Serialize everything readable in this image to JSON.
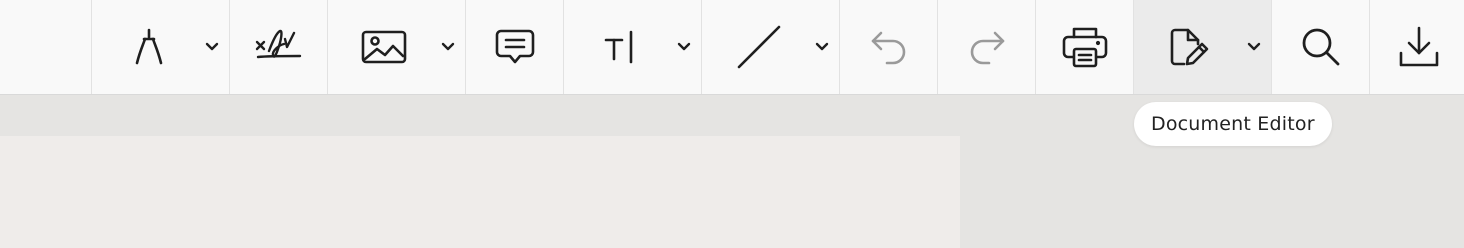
{
  "toolbar": {
    "tools": [
      {
        "id": "pen",
        "icon": "pen-nib-icon",
        "has_dropdown": true
      },
      {
        "id": "signature",
        "icon": "signature-icon",
        "has_dropdown": false
      },
      {
        "id": "image",
        "icon": "image-icon",
        "has_dropdown": true
      },
      {
        "id": "comment",
        "icon": "comment-icon",
        "has_dropdown": false
      },
      {
        "id": "text",
        "icon": "text-cursor-icon",
        "has_dropdown": true
      },
      {
        "id": "line",
        "icon": "line-icon",
        "has_dropdown": true
      },
      {
        "id": "undo",
        "icon": "undo-icon",
        "has_dropdown": false,
        "disabled": true
      },
      {
        "id": "redo",
        "icon": "redo-icon",
        "has_dropdown": false,
        "disabled": true
      },
      {
        "id": "print",
        "icon": "printer-icon",
        "has_dropdown": false
      },
      {
        "id": "document-editor",
        "icon": "document-edit-icon",
        "has_dropdown": true,
        "active": true
      },
      {
        "id": "search",
        "icon": "search-icon",
        "has_dropdown": false
      },
      {
        "id": "download",
        "icon": "download-icon",
        "has_dropdown": false
      }
    ]
  },
  "tooltip": {
    "text": "Document Editor"
  },
  "colors": {
    "toolbar_bg": "#f9f9f9",
    "active_bg": "#ebebeb",
    "icon": "#1f1f1f",
    "icon_disabled": "#9a9a9a",
    "canvas_bg": "#e5e4e2",
    "page_bg": "#efecea"
  }
}
